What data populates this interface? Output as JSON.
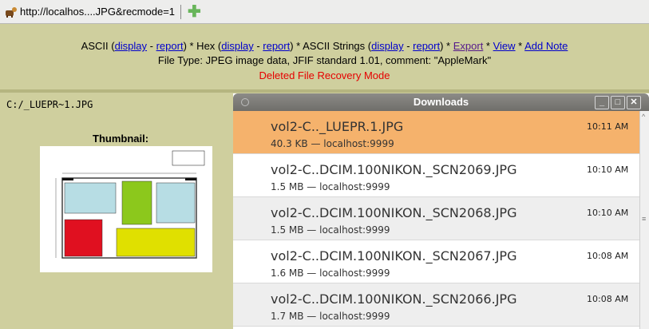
{
  "tab": {
    "url": "http://localhos....JPG&recmode=1"
  },
  "header": {
    "ascii_label": "ASCII (",
    "display1": "display",
    "dash1": " - ",
    "report1": "report",
    "hex_label": ") * Hex (",
    "display2": "display",
    "dash2": " - ",
    "report2": "report",
    "strings_label": ") * ASCII Strings (",
    "display3": "display",
    "dash3": " - ",
    "report3": "report",
    "after_strings": ") * ",
    "export": "Export",
    "star1": " * ",
    "view": "View",
    "star2": " * ",
    "add_note": "Add Note",
    "file_type": "File Type: JPEG image data, JFIF standard 1.01, comment: \"AppleMark\"",
    "mode": "Deleted File Recovery Mode"
  },
  "file_panel": {
    "path": "C:/_LUEPR~1.JPG",
    "thumbnail_label": "Thumbnail:"
  },
  "downloads": {
    "title": "Downloads",
    "items": [
      {
        "name": "vol2-C.._LUEPR.1.JPG",
        "meta": "40.3 KB — localhost:9999",
        "time": "10:11 AM"
      },
      {
        "name": "vol2-C..DCIM.100NIKON._SCN2069.JPG",
        "meta": "1.5 MB — localhost:9999",
        "time": "10:10 AM"
      },
      {
        "name": "vol2-C..DCIM.100NIKON._SCN2068.JPG",
        "meta": "1.5 MB — localhost:9999",
        "time": "10:10 AM"
      },
      {
        "name": "vol2-C..DCIM.100NIKON._SCN2067.JPG",
        "meta": "1.6 MB — localhost:9999",
        "time": "10:08 AM"
      },
      {
        "name": "vol2-C..DCIM.100NIKON._SCN2066.JPG",
        "meta": "1.7 MB — localhost:9999",
        "time": "10:08 AM"
      }
    ]
  },
  "colors": {
    "panel_bg": "#cfcf9e",
    "selected_row": "#f5b26c",
    "mode_text": "#e60000"
  }
}
